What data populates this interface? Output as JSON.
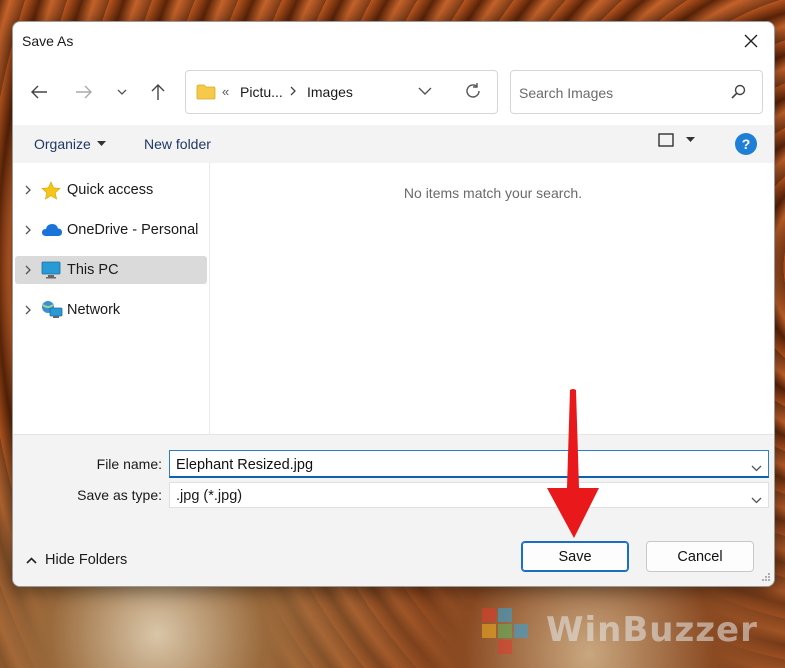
{
  "dialog": {
    "title": "Save As"
  },
  "navigation": {
    "path": [
      {
        "label": "Pictu..."
      },
      {
        "label": "Images"
      }
    ],
    "path_overflow": "«",
    "search_placeholder": "Search Images"
  },
  "toolbar": {
    "organize_label": "Organize",
    "new_folder_label": "New folder",
    "help_label": "?"
  },
  "sidebar": {
    "items": [
      {
        "label": "Quick access",
        "icon": "star-icon",
        "selected": false
      },
      {
        "label": "OneDrive - Personal",
        "icon": "cloud-icon",
        "selected": false
      },
      {
        "label": "This PC",
        "icon": "computer-icon",
        "selected": true
      },
      {
        "label": "Network",
        "icon": "network-icon",
        "selected": false
      }
    ]
  },
  "content": {
    "empty_message": "No items match your search."
  },
  "form": {
    "file_name_label": "File name:",
    "file_name_value": "Elephant Resized.jpg",
    "save_type_label": "Save as type:",
    "save_type_value": ".jpg (*.jpg)"
  },
  "footer": {
    "hide_folders_label": "Hide Folders",
    "save_label": "Save",
    "cancel_label": "Cancel"
  },
  "watermark": {
    "text": "WinBuzzer"
  },
  "colors": {
    "accent": "#1a6fc0",
    "arrow": "#e8181b",
    "star": "#f5c518",
    "help": "#1f7fd6",
    "selected_row": "#dadada"
  }
}
